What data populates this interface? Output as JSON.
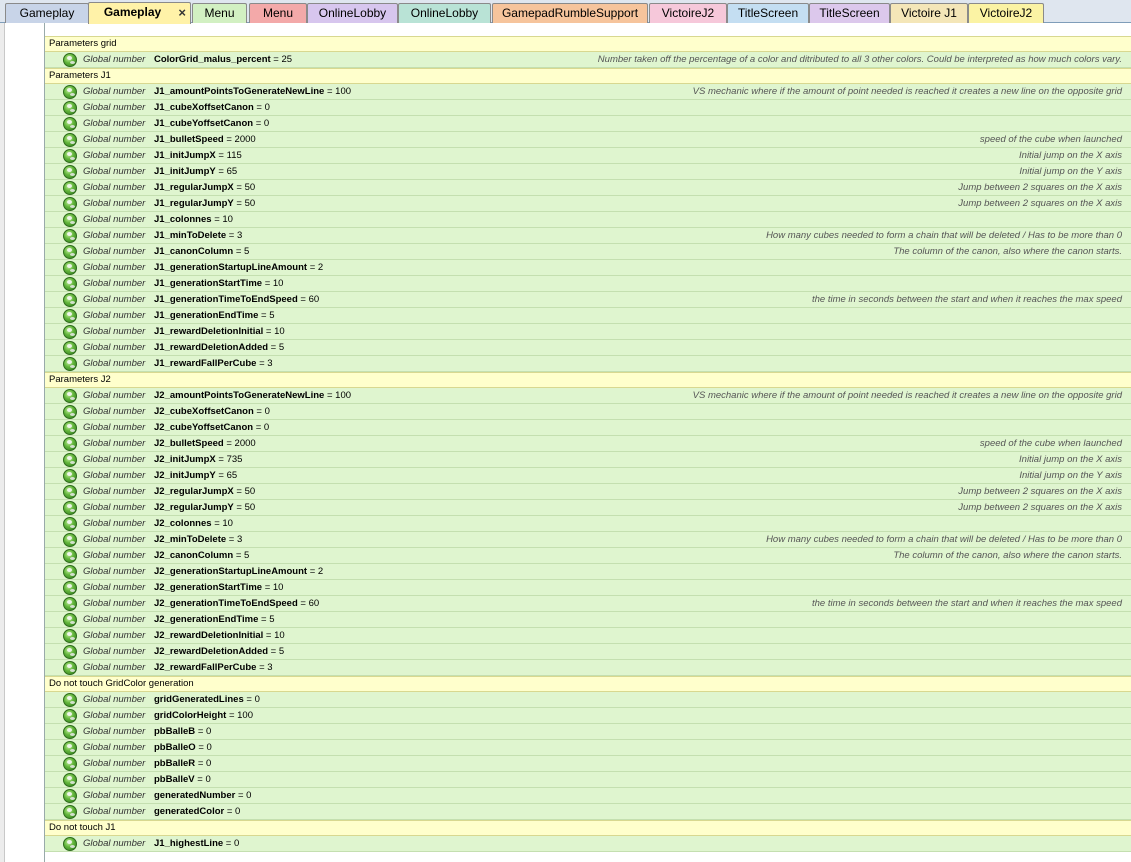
{
  "tabs": [
    {
      "label": "Gameplay",
      "bg": "#c8d4e8",
      "active": false,
      "close": false
    },
    {
      "label": "Gameplay",
      "bg": "#fff2a8",
      "active": true,
      "close": true
    },
    {
      "label": "Menu",
      "bg": "#d2f0c2",
      "active": false,
      "close": false
    },
    {
      "label": "Menu",
      "bg": "#f3a9a9",
      "active": false,
      "close": false
    },
    {
      "label": "OnlineLobby",
      "bg": "#d7c6ee",
      "active": false,
      "close": false
    },
    {
      "label": "OnlineLobby",
      "bg": "#b9e3d6",
      "active": false,
      "close": false
    },
    {
      "label": "GamepadRumbleSupport",
      "bg": "#f6c49c",
      "active": false,
      "close": false
    },
    {
      "label": "VictoireJ2",
      "bg": "#f6c8da",
      "active": false,
      "close": false
    },
    {
      "label": "TitleScreen",
      "bg": "#c4def2",
      "active": false,
      "close": false
    },
    {
      "label": "TitleScreen",
      "bg": "#dcc8ec",
      "active": false,
      "close": false
    },
    {
      "label": "Victoire J1",
      "bg": "#f4e6b8",
      "active": false,
      "close": false
    },
    {
      "label": "VictoireJ2",
      "bg": "#fbf3a4",
      "active": false,
      "close": false
    }
  ],
  "var_kind": "Global number",
  "groups": [
    {
      "title": "Parameters grid",
      "vars": [
        {
          "name": "ColorGrid_malus_percent",
          "value": "25",
          "comment": "Number taken off the percentage of a color and ditributed to all 3 other colors. Could be interpreted as how much colors vary."
        }
      ]
    },
    {
      "title": "Parameters J1",
      "vars": [
        {
          "name": "J1_amountPointsToGenerateNewLine",
          "value": "100",
          "comment": "VS mechanic where if the amount of point needed is reached it creates a new line on the opposite grid"
        },
        {
          "name": "J1_cubeXoffsetCanon",
          "value": "0",
          "comment": ""
        },
        {
          "name": "J1_cubeYoffsetCanon",
          "value": "0",
          "comment": ""
        },
        {
          "name": "J1_bulletSpeed",
          "value": "2000",
          "comment": "speed of the cube when launched"
        },
        {
          "name": "J1_initJumpX",
          "value": "115",
          "comment": "Initial jump on the X axis"
        },
        {
          "name": "J1_initJumpY",
          "value": "65",
          "comment": "Initial jump on the Y axis"
        },
        {
          "name": "J1_regularJumpX",
          "value": "50",
          "comment": "Jump between 2 squares on the X axis"
        },
        {
          "name": "J1_regularJumpY",
          "value": "50",
          "comment": "Jump between 2 squares on the X axis"
        },
        {
          "name": "J1_colonnes",
          "value": "10",
          "comment": ""
        },
        {
          "name": "J1_minToDelete",
          "value": "3",
          "comment": "How many cubes needed to form a chain that will be deleted / Has to be more than 0"
        },
        {
          "name": "J1_canonColumn",
          "value": "5",
          "comment": "The column of the canon, also where the canon starts."
        },
        {
          "name": "J1_generationStartupLineAmount",
          "value": "2",
          "comment": ""
        },
        {
          "name": "J1_generationStartTime",
          "value": "10",
          "comment": ""
        },
        {
          "name": "J1_generationTimeToEndSpeed",
          "value": "60",
          "comment": "the time in seconds between the start and when it reaches the max speed"
        },
        {
          "name": "J1_generationEndTime",
          "value": "5",
          "comment": ""
        },
        {
          "name": "J1_rewardDeletionInitial",
          "value": "10",
          "comment": ""
        },
        {
          "name": "J1_rewardDeletionAdded",
          "value": "5",
          "comment": ""
        },
        {
          "name": "J1_rewardFallPerCube",
          "value": "3",
          "comment": ""
        }
      ]
    },
    {
      "title": "Parameters J2",
      "vars": [
        {
          "name": "J2_amountPointsToGenerateNewLine",
          "value": "100",
          "comment": "VS mechanic where if the amount of point needed is reached it creates a new line on the opposite grid"
        },
        {
          "name": "J2_cubeXoffsetCanon",
          "value": "0",
          "comment": ""
        },
        {
          "name": "J2_cubeYoffsetCanon",
          "value": "0",
          "comment": ""
        },
        {
          "name": "J2_bulletSpeed",
          "value": "2000",
          "comment": "speed of the cube when launched"
        },
        {
          "name": "J2_initJumpX",
          "value": "735",
          "comment": "Initial jump on the X axis"
        },
        {
          "name": "J2_initJumpY",
          "value": "65",
          "comment": "Initial jump on the Y axis"
        },
        {
          "name": "J2_regularJumpX",
          "value": "50",
          "comment": "Jump between 2 squares on the X axis"
        },
        {
          "name": "J2_regularJumpY",
          "value": "50",
          "comment": "Jump between 2 squares on the X axis"
        },
        {
          "name": "J2_colonnes",
          "value": "10",
          "comment": ""
        },
        {
          "name": "J2_minToDelete",
          "value": "3",
          "comment": "How many cubes needed to form a chain that will be deleted / Has to be more than 0"
        },
        {
          "name": "J2_canonColumn",
          "value": "5",
          "comment": "The column of the canon, also where the canon starts."
        },
        {
          "name": "J2_generationStartupLineAmount",
          "value": "2",
          "comment": ""
        },
        {
          "name": "J2_generationStartTime",
          "value": "10",
          "comment": ""
        },
        {
          "name": "J2_generationTimeToEndSpeed",
          "value": "60",
          "comment": "the time in seconds between the start and when it reaches the max speed"
        },
        {
          "name": "J2_generationEndTime",
          "value": "5",
          "comment": ""
        },
        {
          "name": "J2_rewardDeletionInitial",
          "value": "10",
          "comment": ""
        },
        {
          "name": "J2_rewardDeletionAdded",
          "value": "5",
          "comment": ""
        },
        {
          "name": "J2_rewardFallPerCube",
          "value": "3",
          "comment": ""
        }
      ]
    },
    {
      "title": "Do not touch GridColor generation",
      "vars": [
        {
          "name": "gridGeneratedLines",
          "value": "0",
          "comment": ""
        },
        {
          "name": "gridColorHeight",
          "value": "100",
          "comment": ""
        },
        {
          "name": "pbBalleB",
          "value": "0",
          "comment": ""
        },
        {
          "name": "pbBalleO",
          "value": "0",
          "comment": ""
        },
        {
          "name": "pbBalleR",
          "value": "0",
          "comment": ""
        },
        {
          "name": "pbBalleV",
          "value": "0",
          "comment": ""
        },
        {
          "name": "generatedNumber",
          "value": "0",
          "comment": ""
        },
        {
          "name": "generatedColor",
          "value": "0",
          "comment": ""
        }
      ]
    },
    {
      "title": "Do not touch J1",
      "vars": [
        {
          "name": "J1_highestLine",
          "value": "0",
          "comment": ""
        }
      ]
    }
  ]
}
